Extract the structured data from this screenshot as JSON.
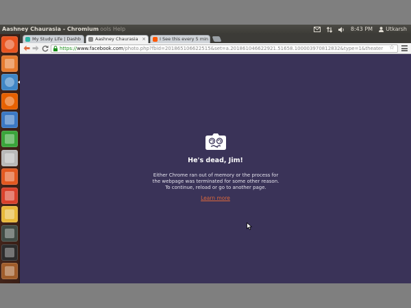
{
  "panel": {
    "window_title": "Aashney Chaurasia - Chromium",
    "menus_hint": "ools  Help",
    "time": "8:43 PM",
    "user": "Utkarsh"
  },
  "launcher": {
    "items": [
      {
        "name": "ubuntu-dash-icon",
        "color": "#e9541f"
      },
      {
        "name": "files-icon",
        "color": "#e67a2e"
      },
      {
        "name": "chromium-icon",
        "color": "#3f86c6"
      },
      {
        "name": "firefox-icon",
        "color": "#e66000"
      },
      {
        "name": "libreoffice-writer-icon",
        "color": "#3b78c4"
      },
      {
        "name": "libreoffice-calc-icon",
        "color": "#3aa53a"
      },
      {
        "name": "camera-icon",
        "color": "#b9b9b9"
      },
      {
        "name": "software-center-icon",
        "color": "#e2581f"
      },
      {
        "name": "ubuntu-one-icon",
        "color": "#d9412b"
      },
      {
        "name": "text-editor-icon",
        "color": "#e8b83a"
      },
      {
        "name": "system-monitor-icon",
        "color": "#3f4a44"
      },
      {
        "name": "terminal-icon",
        "color": "#2c2c2c"
      },
      {
        "name": "archive-icon",
        "color": "#a05c2a"
      }
    ]
  },
  "tabs": [
    {
      "label": "My Study Life | Dashb",
      "icon_color": "#2bb3a3",
      "active": false
    },
    {
      "label": "Aashney Chaurasia",
      "icon_color": "#8a8a8a",
      "active": true
    },
    {
      "label": "I See this every 5 min",
      "icon_color": "#ff5700",
      "active": false
    }
  ],
  "address": {
    "scheme": "https://",
    "host": "www.facebook.com",
    "path": "/photo.php?fbid=201865106622515&set=a.201861046622921.51658.100003970812832&type=1&theater"
  },
  "sad_tab": {
    "title": "He's dead, Jim!",
    "message": "Either Chrome ran out of memory or the process for the webpage was terminated for some other reason.  To continue, reload or go to another page.",
    "link": "Learn more"
  }
}
